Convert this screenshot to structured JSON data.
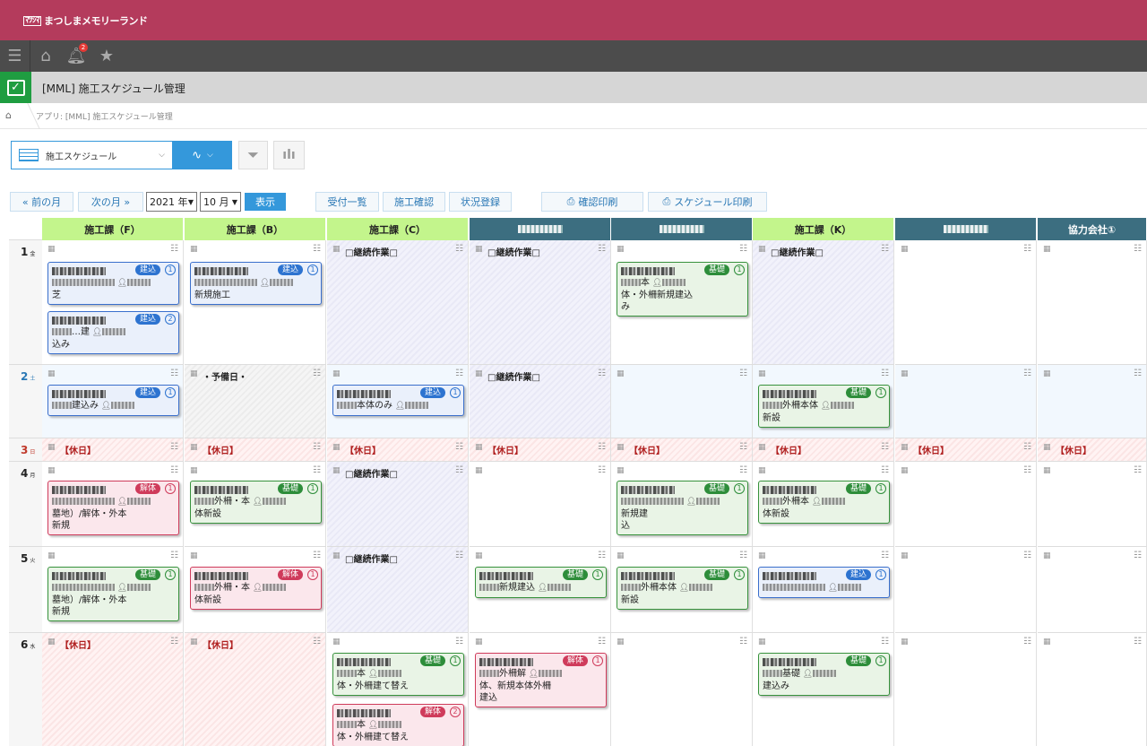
{
  "brand": {
    "mark": "ﾏﾂｼﾏ",
    "name": "まつしまメモリーランド"
  },
  "nav": {
    "notification_count": "2"
  },
  "app": {
    "title": "[MML] 施工スケジュール管理"
  },
  "breadcrumb": {
    "text": "アプリ: [MML] 施工スケジュール管理"
  },
  "view": {
    "selected": "施工スケジュール"
  },
  "toolbar": {
    "prev_month": "« 前の月",
    "next_month": "次の月 »",
    "year": "2021 年",
    "month": "10 月",
    "show": "表示",
    "reception_list": "受付一覧",
    "construction_confirm": "施工確認",
    "status_register": "状況登録",
    "confirm_print": "確認印刷",
    "schedule_print": "スケジュール印刷"
  },
  "columns": [
    {
      "label": "施工課（F）",
      "style": "g"
    },
    {
      "label": "施工課（B）",
      "style": "g"
    },
    {
      "label": "施工課（C）",
      "style": "g"
    },
    {
      "label": "",
      "style": "d"
    },
    {
      "label": "",
      "style": "d"
    },
    {
      "label": "施工課（K）",
      "style": "g"
    },
    {
      "label": "",
      "style": "d"
    },
    {
      "label": "協力会社①",
      "style": "d"
    }
  ],
  "days": [
    {
      "day": "1",
      "weekday": "金",
      "color": "#222"
    },
    {
      "day": "2",
      "weekday": "土",
      "color": "#2a78b5"
    },
    {
      "day": "3",
      "weekday": "日",
      "color": "#c0392b"
    },
    {
      "day": "4",
      "weekday": "月",
      "color": "#222"
    },
    {
      "day": "5",
      "weekday": "火",
      "color": "#222"
    },
    {
      "day": "6",
      "weekday": "水",
      "color": "#222"
    }
  ],
  "labels": {
    "continue_work": "□継続作業□",
    "holiday": "【休日】",
    "reserve_day": "・予備日・"
  },
  "cards": {
    "d1c1a": {
      "tag": "建込",
      "num": "1",
      "line2": "芝"
    },
    "d1c1b": {
      "tag": "建込",
      "num": "2",
      "line1": "…建",
      "line2": "込み"
    },
    "d1c2": {
      "tag": "建込",
      "num": "1",
      "line2": "新規施工"
    },
    "d1c5": {
      "tag": "基礎",
      "num": "1",
      "line1": "本",
      "line2": "体・外柵新規建込",
      "line3": "み"
    },
    "d2c1": {
      "tag": "建込",
      "num": "1",
      "line1": "建込み"
    },
    "d2c3": {
      "tag": "建込",
      "num": "1",
      "line1": "本体のみ"
    },
    "d2c6": {
      "tag": "基礎",
      "num": "1",
      "line1": "外柵本体",
      "line2": "新設"
    },
    "d4c1": {
      "tag": "解体",
      "num": "1",
      "line2": "墓地）/解体・外本",
      "line3": "新規"
    },
    "d4c2": {
      "tag": "基礎",
      "num": "1",
      "line1": "外柵・本",
      "line2": "体新設"
    },
    "d4c5": {
      "tag": "基礎",
      "num": "1",
      "line2": "新規建",
      "line3": "込"
    },
    "d4c6": {
      "tag": "基礎",
      "num": "1",
      "line1": "外柵本",
      "line2": "体新設"
    },
    "d5c1": {
      "tag": "基礎",
      "num": "1",
      "line2": "墓地）/解体・外本",
      "line3": "新規"
    },
    "d5c2": {
      "tag": "解体",
      "num": "1",
      "line1": "外柵・本",
      "line2": "体新設"
    },
    "d5c4": {
      "tag": "基礎",
      "num": "1",
      "line1": "新規建込"
    },
    "d5c5": {
      "tag": "基礎",
      "num": "1",
      "line1": "外柵本体",
      "line2": "新設"
    },
    "d5c6": {
      "tag": "建込",
      "num": "1"
    },
    "d6c3a": {
      "tag": "基礎",
      "num": "1",
      "line1": "本",
      "line2": "体・外柵建て替え"
    },
    "d6c3b": {
      "tag": "解体",
      "num": "2",
      "line1": "本",
      "line2": "体・外柵建て替え"
    },
    "d6c4": {
      "tag": "解体",
      "num": "1",
      "line1": "外柵解",
      "line2": "体、新規本体外柵",
      "line3": "建込"
    },
    "d6c6": {
      "tag": "基礎",
      "num": "1",
      "line1": "基礎",
      "line2": "建込み"
    }
  }
}
